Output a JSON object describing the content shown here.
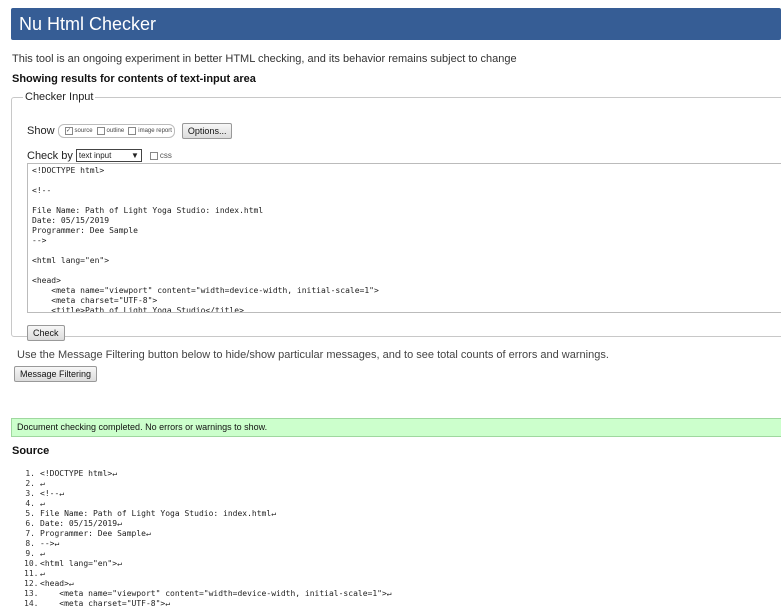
{
  "header": {
    "title": "Nu Html Checker"
  },
  "intro": "This tool is an ongoing experiment in better HTML checking, and its behavior remains subject to change",
  "showing": "Showing results for contents of text-input area",
  "checker": {
    "legend": "Checker Input",
    "show_label": "Show",
    "show_options": [
      {
        "label": "source",
        "checked": true
      },
      {
        "label": "outline",
        "checked": false
      },
      {
        "label": "image report",
        "checked": false
      }
    ],
    "options_button": "Options...",
    "checkby_label": "Check by",
    "checkby_value": "text input",
    "css_label": "css",
    "textarea": "<!DOCTYPE html>\n\n<!--\n\nFile Name: Path of Light Yoga Studio: index.html\nDate: 05/15/2019\nProgrammer: Dee Sample\n-->\n\n<html lang=\"en\">\n\n<head>\n    <meta name=\"viewport\" content=\"width=device-width, initial-scale=1\">\n    <meta charset=\"UTF-8\">\n    <title>Path of Light Yoga Studio</title>",
    "check_button": "Check"
  },
  "filter": {
    "text": "Use the Message Filtering button below to hide/show particular messages, and to see total counts of errors and warnings.",
    "button": "Message Filtering"
  },
  "result": "Document checking completed. No errors or warnings to show.",
  "source": {
    "heading": "Source",
    "lines": [
      {
        "n": "1.",
        "code": "<!DOCTYPE html>↵"
      },
      {
        "n": "2.",
        "code": "↵"
      },
      {
        "n": "3.",
        "code": "<!--↵"
      },
      {
        "n": "4.",
        "code": "↵"
      },
      {
        "n": "5.",
        "code": "File Name: Path of Light Yoga Studio: index.html↵"
      },
      {
        "n": "6.",
        "code": "Date: 05/15/2019↵"
      },
      {
        "n": "7.",
        "code": "Programmer: Dee Sample↵"
      },
      {
        "n": "8.",
        "code": "-->↵"
      },
      {
        "n": "9.",
        "code": "↵"
      },
      {
        "n": "10.",
        "code": "<html lang=\"en\">↵"
      },
      {
        "n": "11.",
        "code": "↵"
      },
      {
        "n": "12.",
        "code": "<head>↵"
      },
      {
        "n": "13.",
        "code": "    <meta name=\"viewport\" content=\"width=device-width, initial-scale=1\">↵"
      },
      {
        "n": "14.",
        "code": "    <meta charset=\"UTF-8\">↵"
      }
    ]
  },
  "colors": {
    "header_bg": "#365d95",
    "success_bg": "#ccffcc"
  }
}
